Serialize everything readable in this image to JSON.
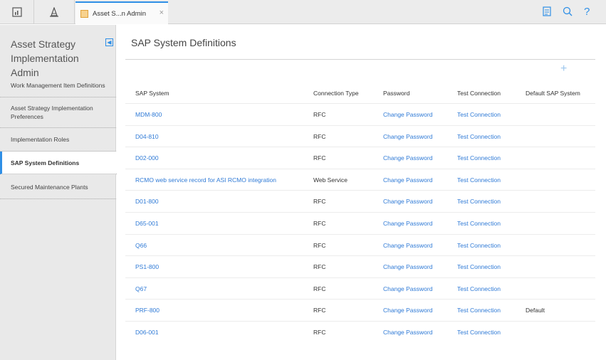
{
  "topbar": {
    "home_icon": "dashboard-icon",
    "hierarchy_icon": "hierarchy-icon",
    "tab": {
      "label": "Asset S...n Admin",
      "close": "×",
      "icon": "asset-strategy-icon"
    },
    "right_icons": {
      "news": "news-icon",
      "search": "search-icon",
      "help": "?"
    }
  },
  "sidebar": {
    "title": "Asset Strategy Implementation Admin",
    "collapse_icon": "collapse-left-icon",
    "items": [
      {
        "label": "Work Management Item Definitions"
      },
      {
        "label": "Asset Strategy Implementation Preferences"
      },
      {
        "label": "Implementation Roles"
      },
      {
        "label": "SAP System Definitions"
      },
      {
        "label": "Secured Maintenance Plants"
      }
    ],
    "active_index": 3
  },
  "main": {
    "title": "SAP System Definitions",
    "add_label": "+",
    "columns": [
      "SAP System",
      "Connection Type",
      "Password",
      "Test Connection",
      "Default SAP System"
    ],
    "rows": [
      {
        "system": "MDM-800",
        "type": "RFC",
        "password": "Change Password",
        "test": "Test Connection",
        "default": ""
      },
      {
        "system": "D04-810",
        "type": "RFC",
        "password": "Change Password",
        "test": "Test Connection",
        "default": ""
      },
      {
        "system": "D02-000",
        "type": "RFC",
        "password": "Change Password",
        "test": "Test Connection",
        "default": ""
      },
      {
        "system": "RCMO web service record for ASI RCMO integration",
        "type": "Web Service",
        "password": "Change Password",
        "test": "Test Connection",
        "default": ""
      },
      {
        "system": "D01-800",
        "type": "RFC",
        "password": "Change Password",
        "test": "Test Connection",
        "default": ""
      },
      {
        "system": "D65-001",
        "type": "RFC",
        "password": "Change Password",
        "test": "Test Connection",
        "default": ""
      },
      {
        "system": "Q66",
        "type": "RFC",
        "password": "Change Password",
        "test": "Test Connection",
        "default": ""
      },
      {
        "system": "PS1-800",
        "type": "RFC",
        "password": "Change Password",
        "test": "Test Connection",
        "default": ""
      },
      {
        "system": "Q67",
        "type": "RFC",
        "password": "Change Password",
        "test": "Test Connection",
        "default": ""
      },
      {
        "system": "PRF-800",
        "type": "RFC",
        "password": "Change Password",
        "test": "Test Connection",
        "default": "Default"
      },
      {
        "system": "D06-001",
        "type": "RFC",
        "password": "Change Password",
        "test": "Test Connection",
        "default": ""
      }
    ]
  },
  "colors": {
    "accent": "#2f8fe6",
    "link": "#2f7ad6"
  }
}
